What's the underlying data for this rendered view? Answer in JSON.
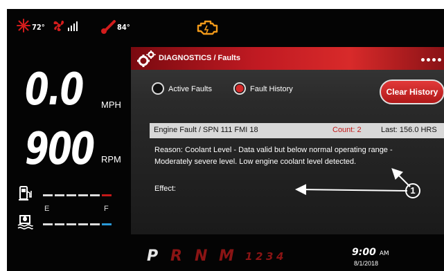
{
  "status": {
    "outside_temp": "72°",
    "coolant_temp": "84°",
    "icons": [
      "snowflake-icon",
      "fan-icon",
      "signal-bars-icon",
      "thermometer-icon",
      "check-engine-icon"
    ]
  },
  "gauges": {
    "speed": "0.0",
    "speed_unit": "MPH",
    "rpm": "900",
    "rpm_unit": "RPM",
    "fuel_empty_label": "E",
    "fuel_full_label": "F",
    "fuel_level": 0.9
  },
  "diagnostics": {
    "title": "DIAGNOSTICS / Faults",
    "tab_active": "Active Faults",
    "tab_history": "Fault History",
    "selected_tab": "Fault History",
    "clear_button": "Clear History",
    "fault": {
      "title": "Engine Fault / SPN 111 FMI 18",
      "count": "Count: 2",
      "last": "Last: 156.0 HRS"
    },
    "reason_line1": "Reason: Coolant Level - Data valid but below normal operating range -",
    "reason_line2": "Moderately severe level.  Low engine coolant level detected.",
    "effect": "Effect:",
    "callout": "1"
  },
  "gear_selector": {
    "p": "P",
    "r": "R",
    "n": "N",
    "m": "M",
    "g1": "1",
    "g2": "2",
    "g3": "3",
    "g4": "4",
    "active": "P"
  },
  "clock": {
    "time": "9:00",
    "ampm": "AM",
    "date": "8/1/2018"
  },
  "colors": {
    "accent_red": "#c01a22",
    "check_engine": "#f29a1a",
    "fuel_low": "#c41818",
    "water_marker": "#2a9ad8"
  }
}
